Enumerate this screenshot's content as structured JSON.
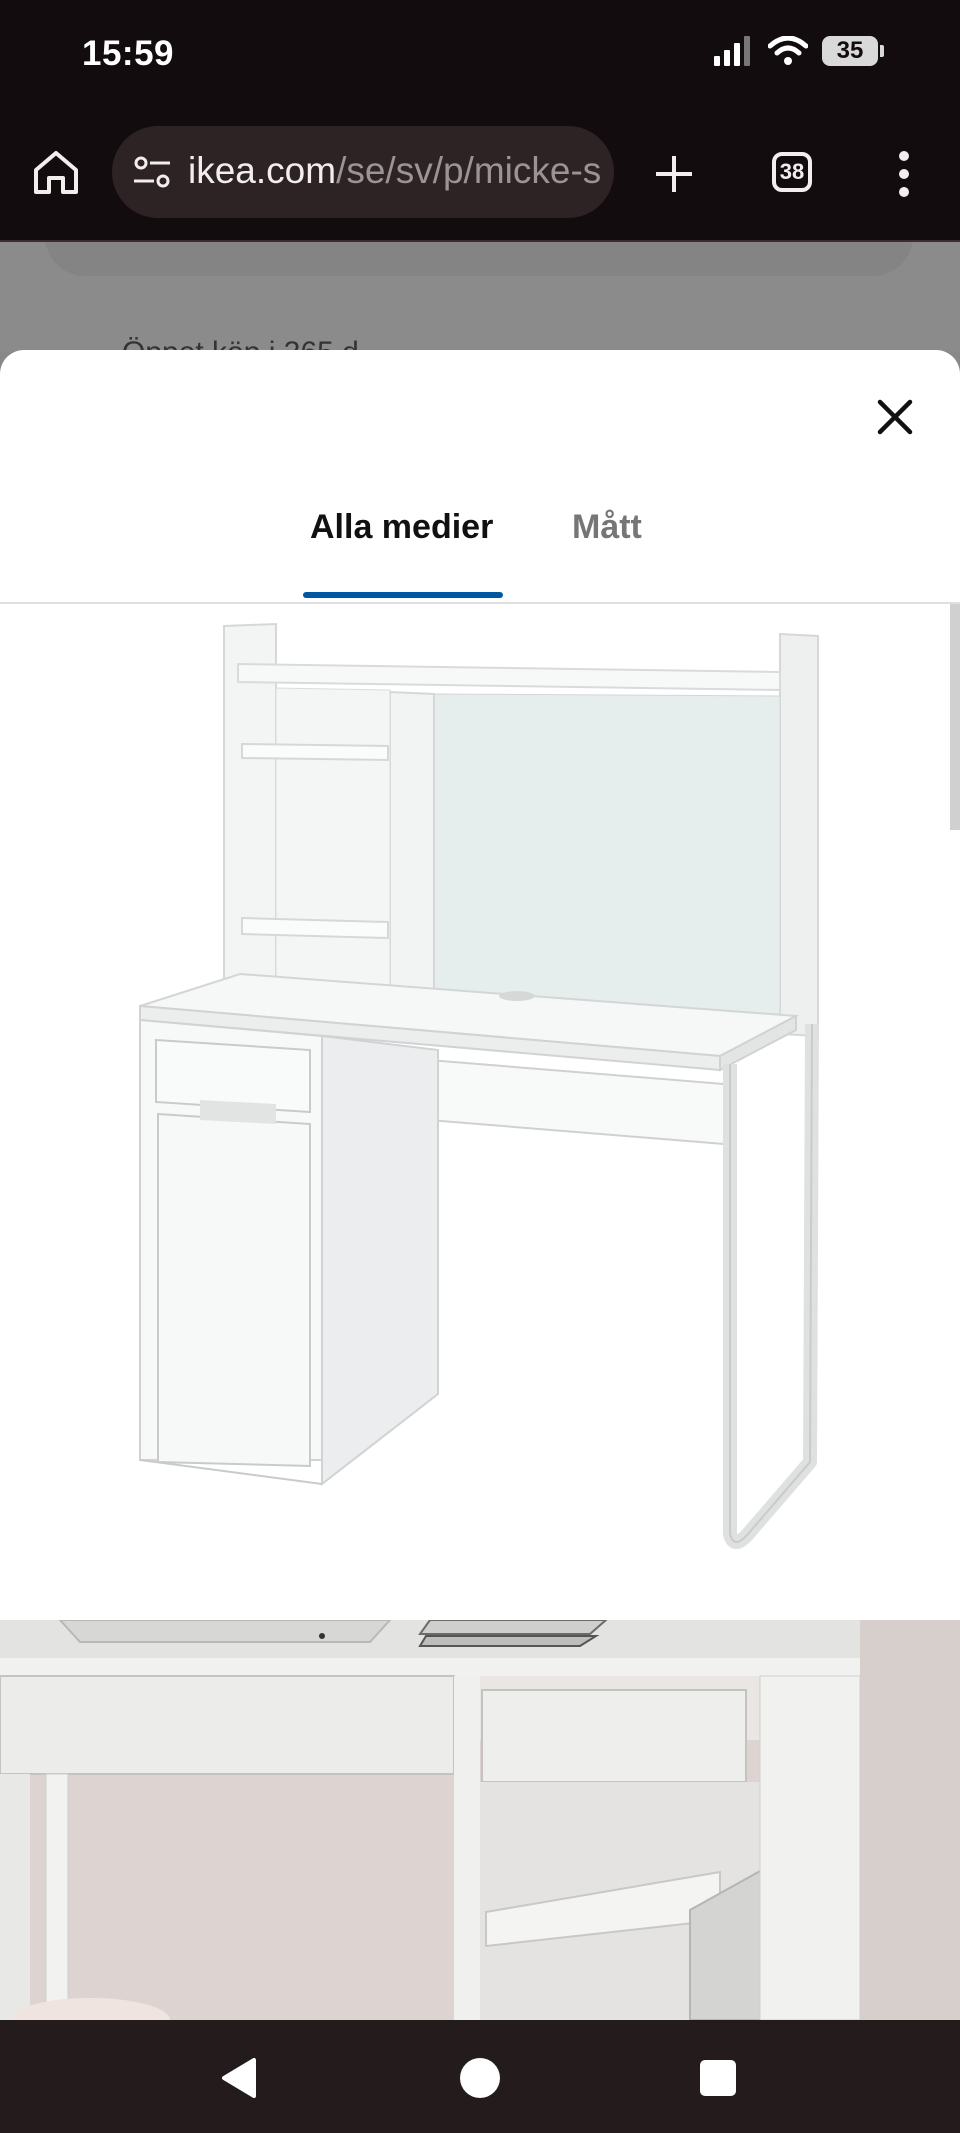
{
  "status_bar": {
    "time": "15:59",
    "battery": "35"
  },
  "browser": {
    "url_host": "ikea.com",
    "url_path": "/se/sv/p/micke-s",
    "tab_count": "38"
  },
  "background_page": {
    "text": "Öppet köp i 365 d"
  },
  "sheet": {
    "tabs": [
      {
        "label": "Alla medier",
        "selected": true
      },
      {
        "label": "Mått",
        "selected": false
      }
    ]
  },
  "icons": {
    "home": "home-icon",
    "tune": "site-info-icon",
    "plus": "new-tab-icon",
    "tabs": "tab-switcher-icon",
    "menu": "more-vert-icon",
    "close": "close-icon",
    "back": "nav-back-icon",
    "home_nav": "nav-home-icon",
    "recents": "nav-recents-icon"
  },
  "colors": {
    "accent": "#0058a3",
    "chrome_bg": "#130c0e"
  }
}
